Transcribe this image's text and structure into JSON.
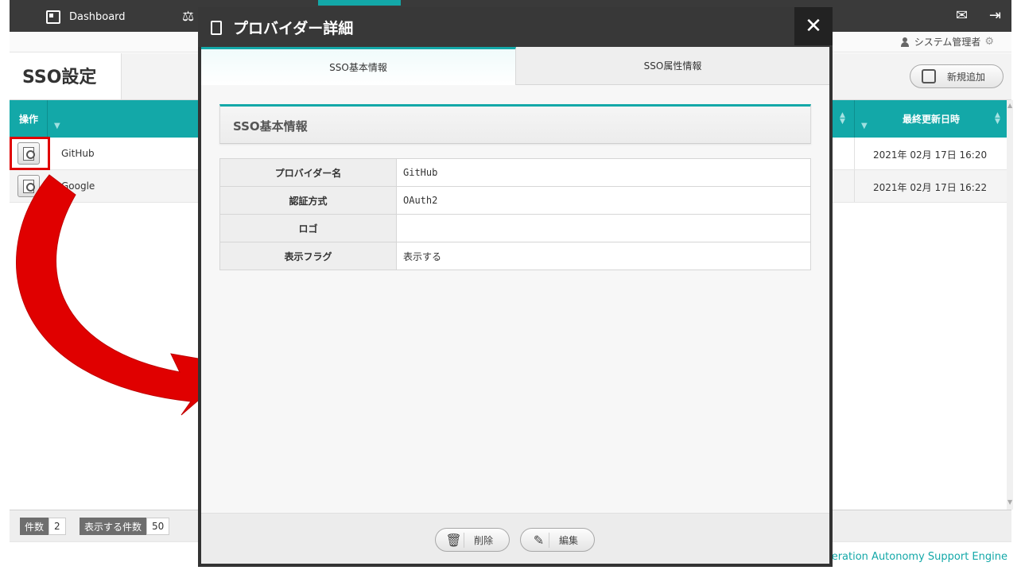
{
  "nav": {
    "dashboard_label": "Dashboard",
    "scale_icon": "⚖",
    "mail_icon": "✉",
    "logout_icon": "⇥"
  },
  "user": {
    "label": "システム管理者",
    "gear_icon": "⚙"
  },
  "page": {
    "title": "SSO設定",
    "new_button_label": "新規追加"
  },
  "table": {
    "op_header": "操作",
    "last_updated_header": "最終更新日時",
    "filter_icon": "▼",
    "sort_icon_up": "▲",
    "sort_icon_down": "▼",
    "rows": [
      {
        "name": "GitHub",
        "updated": "2021年 02月 17日 16:20"
      },
      {
        "name": "Google",
        "updated": "2021年 02月 17日 16:22"
      }
    ]
  },
  "footer": {
    "count_label": "件数",
    "count_value": "2",
    "show_label": "表示する件数",
    "show_value": "50",
    "brand_text": "Operation Autonomy Support Engine"
  },
  "modal": {
    "title": "プロバイダー詳細",
    "close_icon": "✕",
    "tabs": [
      {
        "label": "SSO基本情報",
        "active": true
      },
      {
        "label": "SSO属性情報",
        "active": false
      }
    ],
    "section_title": "SSO基本情報",
    "fields": [
      {
        "key": "プロバイダー名",
        "value": "GitHub"
      },
      {
        "key": "認証方式",
        "value": "OAuth2"
      },
      {
        "key": "ロゴ",
        "value": ""
      },
      {
        "key": "表示フラグ",
        "value": "表示する"
      }
    ],
    "delete_label": "削除",
    "edit_label": "編集",
    "delete_icon": "🗑",
    "edit_icon": "✎"
  },
  "colors": {
    "accent": "#13a8a8",
    "dark_bar": "#3a3a3a",
    "arrow_red": "#e00000"
  }
}
